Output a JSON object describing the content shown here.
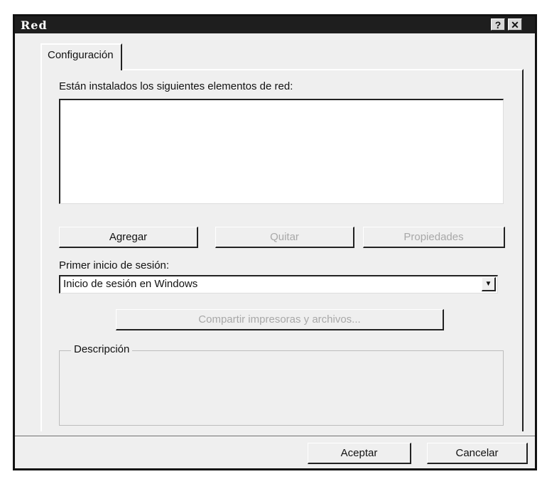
{
  "window": {
    "title": "Red",
    "help_icon": "help-icon",
    "close_icon": "close-icon"
  },
  "tabs": [
    {
      "label": "Configuración"
    }
  ],
  "components": {
    "label": "Están instalados los siguientes elementos de red:",
    "items": []
  },
  "buttons": {
    "add": "Agregar",
    "remove": "Quitar",
    "properties": "Propiedades",
    "share": "Compartir impresoras y archivos...",
    "ok": "Aceptar",
    "cancel": "Cancelar"
  },
  "logon": {
    "label": "Primer inicio de sesión:",
    "selected": "Inicio de sesión en Windows"
  },
  "description": {
    "legend": "Descripción",
    "text": ""
  }
}
